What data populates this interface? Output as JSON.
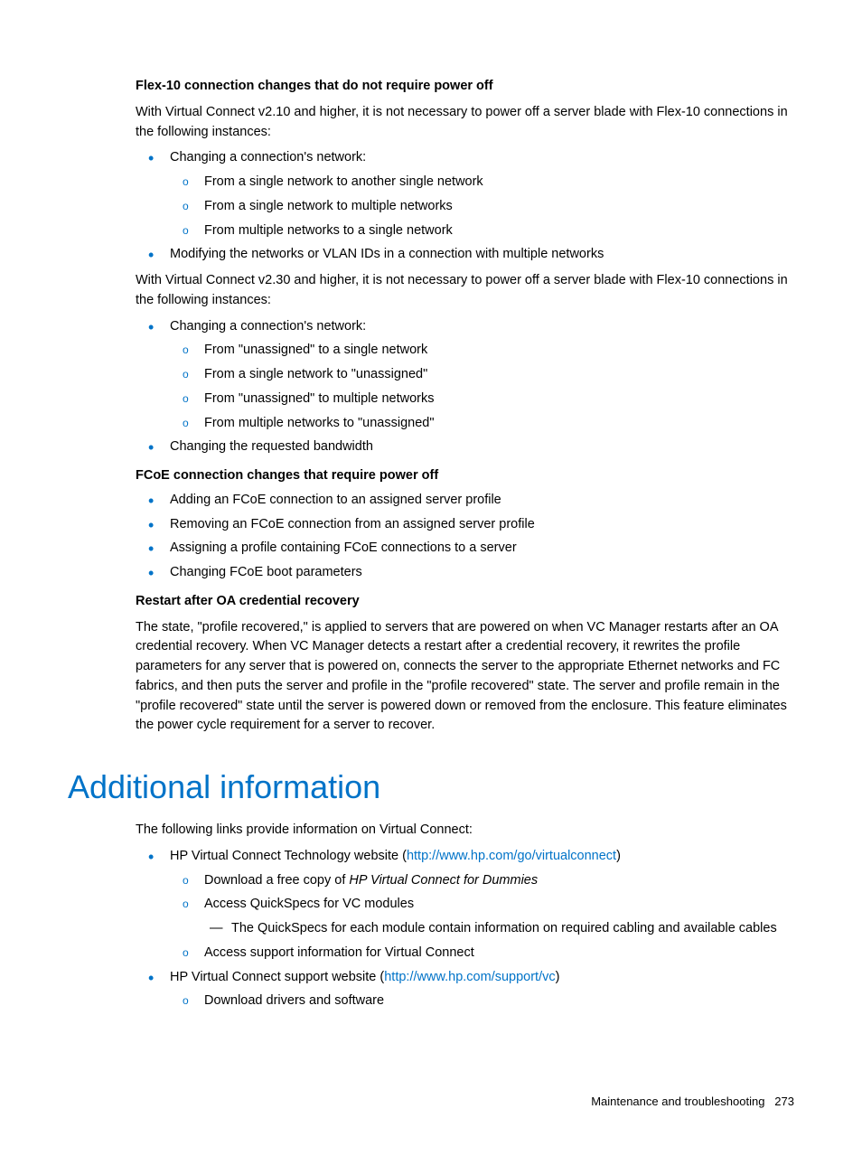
{
  "h1": "Flex-10 connection changes that do not require power off",
  "p1": "With Virtual Connect v2.10 and higher, it is not necessary to power off a server blade with Flex-10 connections in the following instances:",
  "l1a": "Changing a connection's network:",
  "l1a1": "From a single network to another single network",
  "l1a2": "From a single network to multiple networks",
  "l1a3": "From multiple networks to a single network",
  "l1b": "Modifying the networks or VLAN IDs in a connection with multiple networks",
  "p2": "With Virtual Connect v2.30 and higher, it is not necessary to power off a server blade with Flex-10 connections in the following instances:",
  "l2a": "Changing a connection's network:",
  "l2a1": "From \"unassigned\" to a single network",
  "l2a2": "From a single network to \"unassigned\"",
  "l2a3": "From \"unassigned\" to multiple networks",
  "l2a4": "From multiple networks to \"unassigned\"",
  "l2b": "Changing the requested bandwidth",
  "h2": "FCoE connection changes that require power off",
  "l3a": "Adding an FCoE connection to an assigned server profile",
  "l3b": "Removing an FCoE connection from an assigned server profile",
  "l3c": "Assigning a profile containing FCoE connections to a server",
  "l3d": "Changing FCoE boot parameters",
  "h3": "Restart after OA credential recovery",
  "p3": "The state, \"profile recovered,\" is applied to servers that are powered on when VC Manager restarts after an OA credential recovery. When VC Manager detects a restart after a credential recovery, it rewrites the profile parameters for any server that is powered on, connects the server to the appropriate Ethernet networks and FC fabrics, and then puts the server and profile in the \"profile recovered\" state. The server and profile remain in the \"profile recovered\" state until the server is powered down or removed from the enclosure. This feature eliminates the power cycle requirement for a server to recover.",
  "section_title": "Additional information",
  "p4": "The following links provide information on Virtual Connect:",
  "l4a_pre": "HP Virtual Connect Technology website (",
  "l4a_link": "http://www.hp.com/go/virtualconnect",
  "l4a_post": ")",
  "l4a1_pre": "Download a free copy of ",
  "l4a1_italic": "HP Virtual Connect for Dummies",
  "l4a2": "Access QuickSpecs for VC modules",
  "l4a2a": "The QuickSpecs for each module contain information on required cabling and available cables",
  "l4a3": "Access support information for Virtual Connect",
  "l4b_pre": "HP Virtual Connect support website (",
  "l4b_link": "http://www.hp.com/support/vc",
  "l4b_post": ")",
  "l4b1": "Download drivers and software",
  "footer_text": "Maintenance and troubleshooting",
  "footer_page": "273"
}
